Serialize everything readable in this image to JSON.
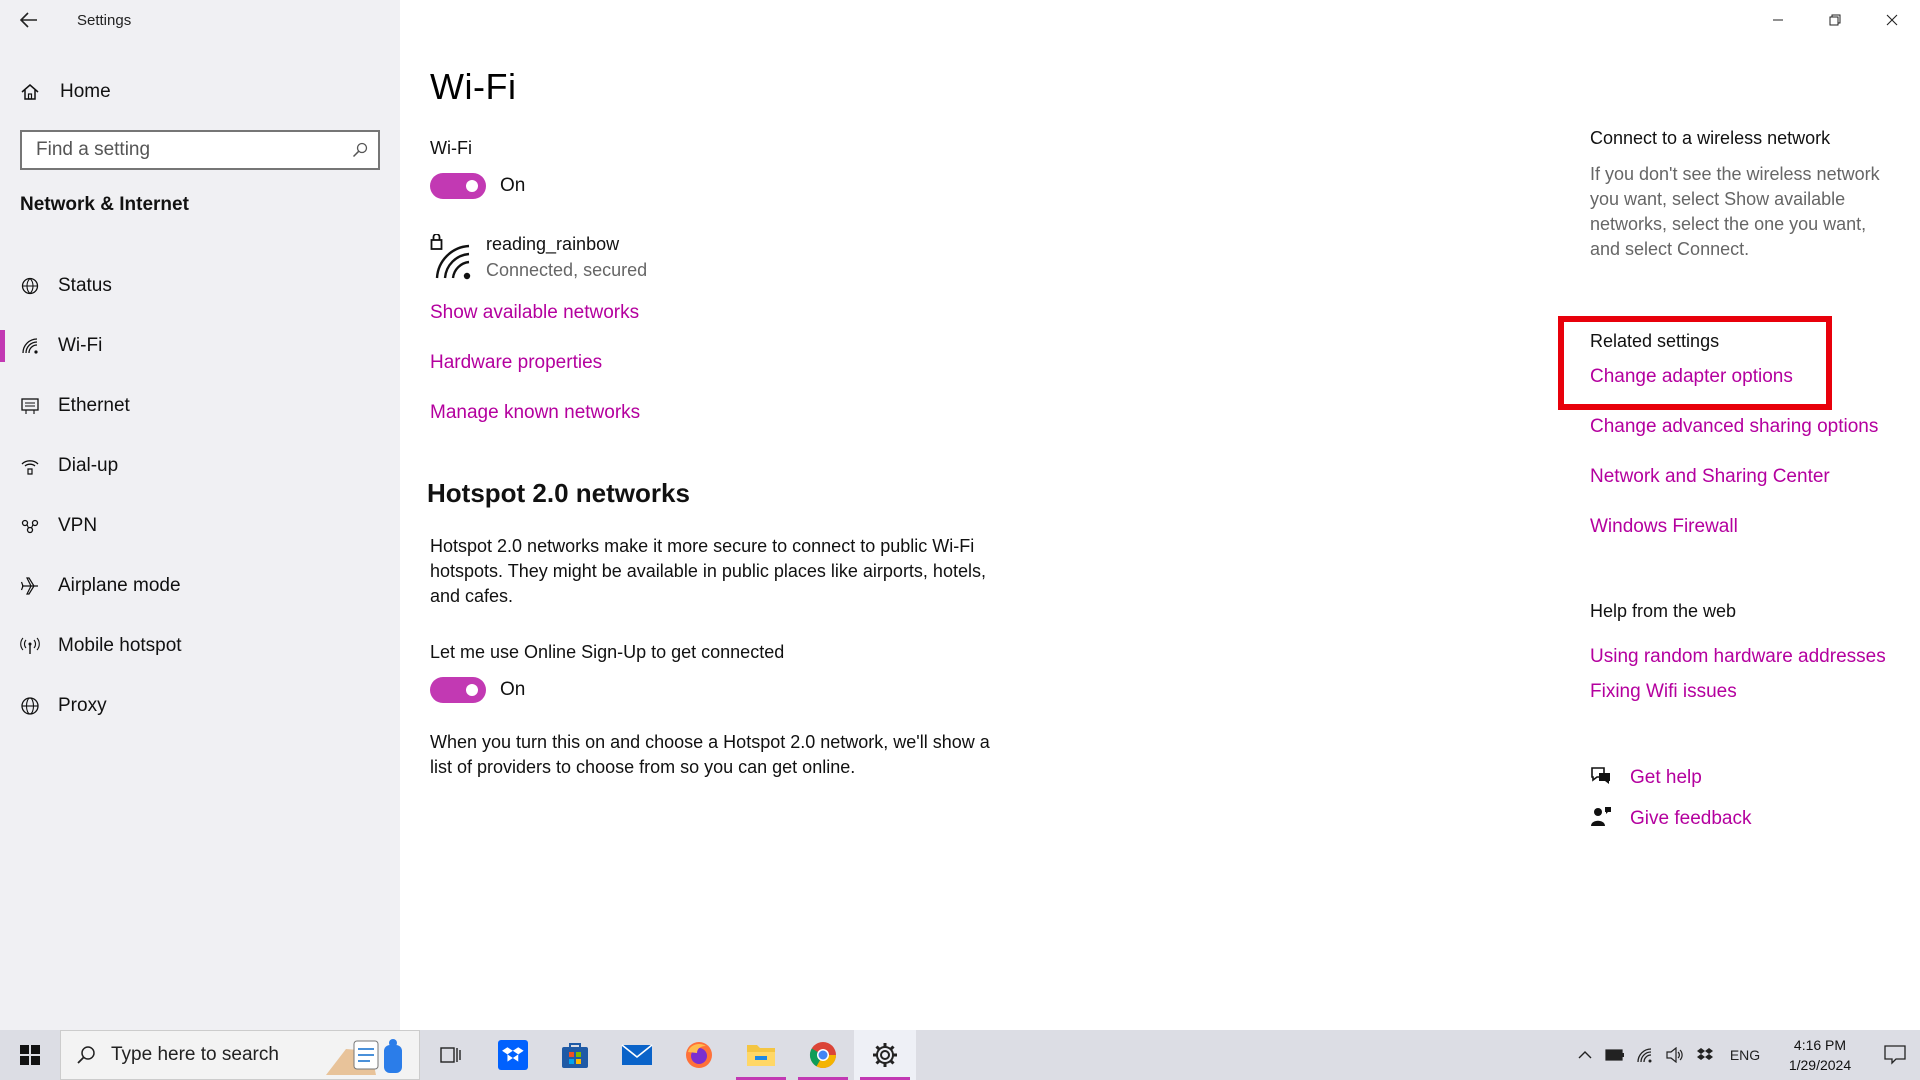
{
  "window": {
    "title": "Settings"
  },
  "sidebar": {
    "home_label": "Home",
    "search": {
      "placeholder": "Find a setting"
    },
    "section_title": "Network & Internet",
    "items": [
      {
        "label": "Status",
        "icon": "globe-status-icon",
        "active": false
      },
      {
        "label": "Wi-Fi",
        "icon": "wifi-icon",
        "active": true
      },
      {
        "label": "Ethernet",
        "icon": "ethernet-icon",
        "active": false
      },
      {
        "label": "Dial-up",
        "icon": "dialup-icon",
        "active": false
      },
      {
        "label": "VPN",
        "icon": "vpn-icon",
        "active": false
      },
      {
        "label": "Airplane mode",
        "icon": "airplane-icon",
        "active": false
      },
      {
        "label": "Mobile hotspot",
        "icon": "hotspot-icon",
        "active": false
      },
      {
        "label": "Proxy",
        "icon": "globe-icon",
        "active": false
      }
    ]
  },
  "main": {
    "title": "Wi-Fi",
    "wifi_label": "Wi-Fi",
    "wifi_toggle_state": "On",
    "network": {
      "name": "reading_rainbow",
      "status": "Connected, secured"
    },
    "links": {
      "show_available": "Show available networks",
      "hardware_properties": "Hardware properties",
      "manage_known": "Manage known networks"
    },
    "hotspot": {
      "heading": "Hotspot 2.0 networks",
      "description": "Hotspot 2.0 networks make it more secure to connect to public Wi-Fi hotspots. They might be available in public places like airports, hotels, and cafes.",
      "signup_label": "Let me use Online Sign-Up to get connected",
      "signup_toggle_state": "On",
      "note": "When you turn this on and choose a Hotspot 2.0 network, we'll show a list of providers to choose from so you can get online."
    }
  },
  "right": {
    "connect_heading": "Connect to a wireless network",
    "connect_text": "If you don't see the wireless network you want, select Show available networks, select the one you want, and select Connect.",
    "related_heading": "Related settings",
    "related_links": [
      "Change adapter options",
      "Change advanced sharing options",
      "Network and Sharing Center",
      "Windows Firewall"
    ],
    "help_heading": "Help from the web",
    "help_links": [
      "Using random hardware addresses",
      "Fixing Wifi issues"
    ],
    "get_help": "Get help",
    "give_feedback": "Give feedback"
  },
  "taskbar": {
    "search_text": "Type here to search",
    "apps": [
      {
        "name": "task-view",
        "running": false
      },
      {
        "name": "dropbox",
        "running": false
      },
      {
        "name": "microsoft-store",
        "running": false
      },
      {
        "name": "mail",
        "running": false
      },
      {
        "name": "firefox",
        "running": false
      },
      {
        "name": "file-explorer",
        "running": true
      },
      {
        "name": "chrome",
        "running": true
      },
      {
        "name": "settings",
        "running": true
      }
    ],
    "tray": {
      "language": "ENG",
      "time": "4:16 PM",
      "date": "1/29/2024"
    }
  },
  "colors": {
    "accent": "#c239b3",
    "link": "#b4009e",
    "highlight_box": "#e8000b",
    "sidebar_bg": "#f0f0f3"
  }
}
